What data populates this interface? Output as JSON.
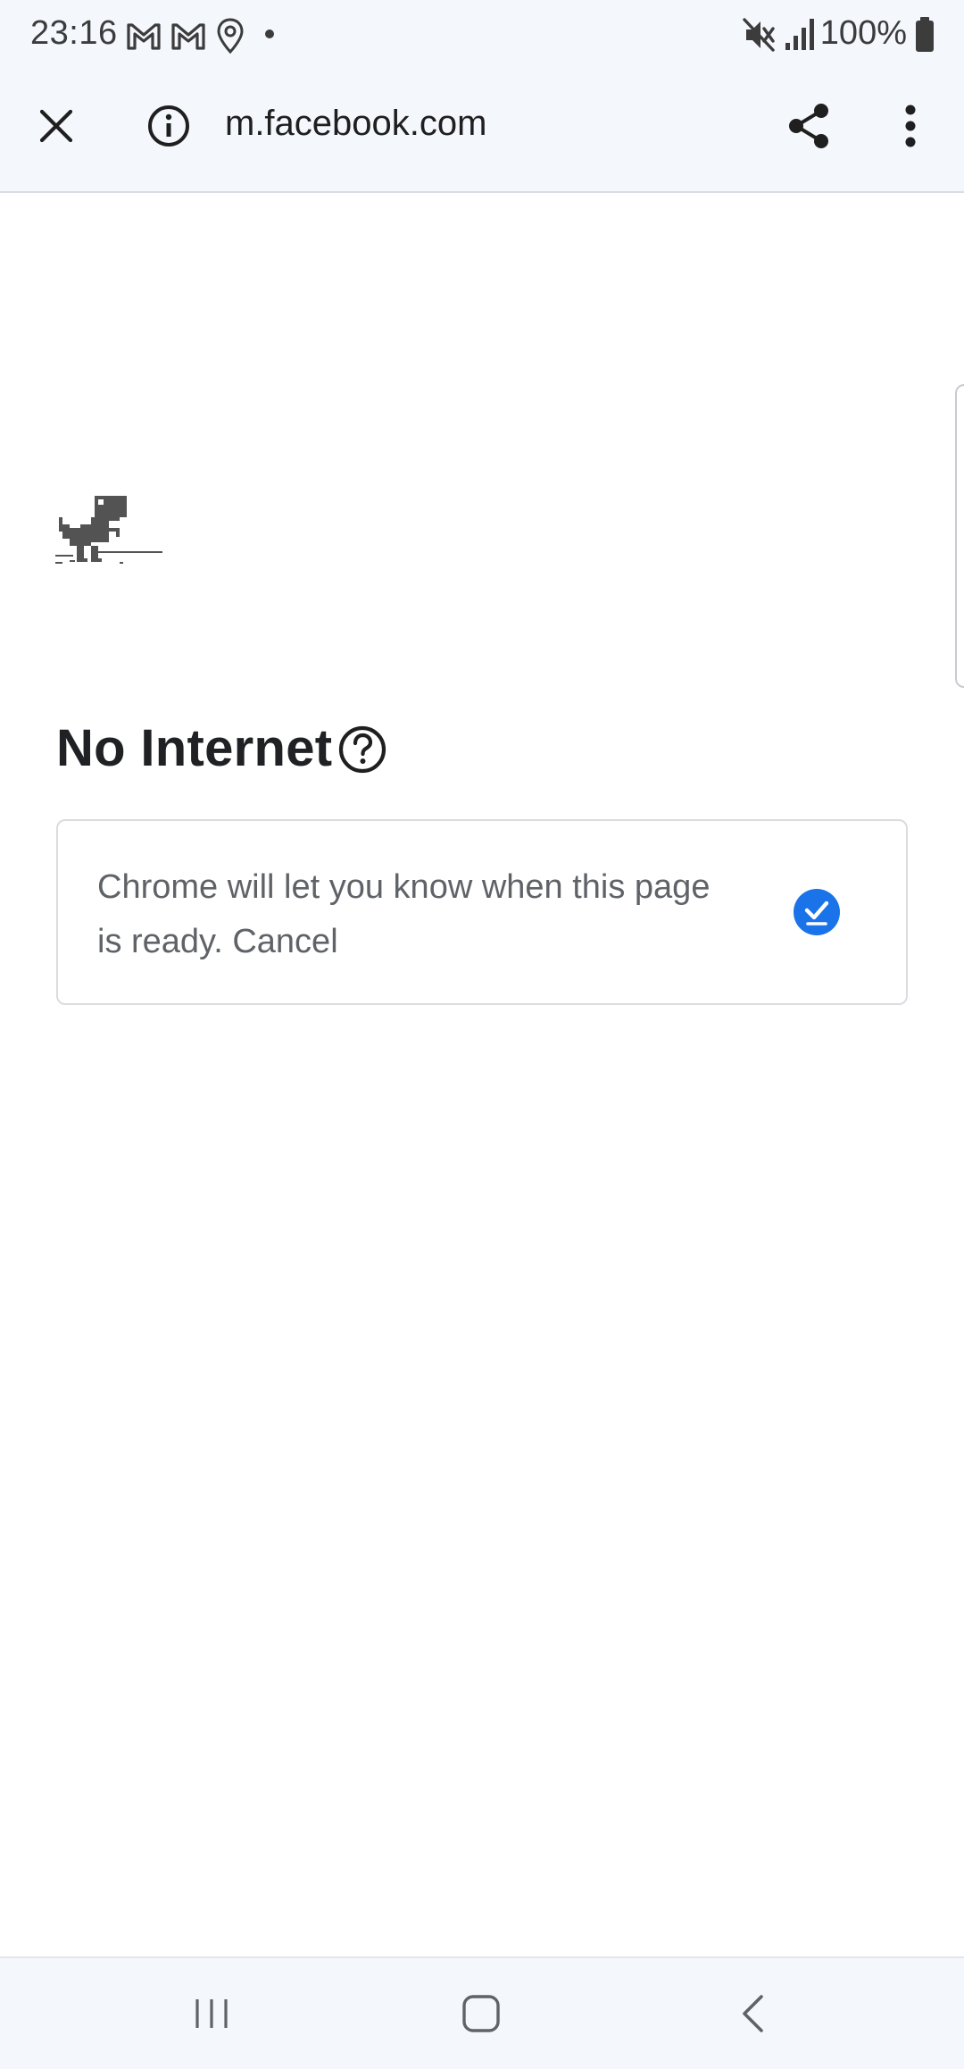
{
  "status_bar": {
    "time": "23:16",
    "battery": "100%",
    "icons": [
      "gmail-icon",
      "gmail-icon",
      "location-icon",
      "dot-icon",
      "mute-icon",
      "signal-icon",
      "battery-icon"
    ]
  },
  "toolbar": {
    "url": "m.facebook.com",
    "icons": [
      "close-icon",
      "info-icon",
      "share-icon",
      "more-vert-icon"
    ]
  },
  "content": {
    "title": "No Internet",
    "notify_text": "Chrome will let you know when this page is ready. Cancel",
    "icons": [
      "dino-icon",
      "help-icon",
      "check-icon"
    ]
  },
  "nav_bar": {
    "icons": [
      "recents-icon",
      "home-icon",
      "back-icon"
    ]
  },
  "colors": {
    "bar_background": "#f4f7fc",
    "accent": "#1a73e8",
    "title": "#202124",
    "secondary_text": "#5f6368"
  }
}
